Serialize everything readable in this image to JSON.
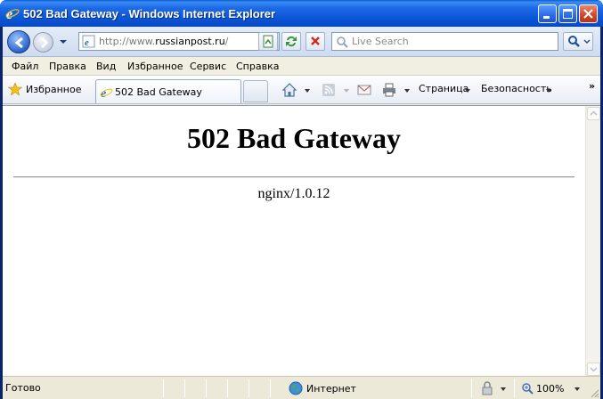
{
  "window": {
    "title": "502 Bad Gateway - Windows Internet Explorer"
  },
  "address": {
    "url_prefix": "http://www.",
    "url_domain": "russianpost.ru",
    "url_suffix": "/"
  },
  "search": {
    "placeholder": "Live Search"
  },
  "menu": {
    "items": [
      "Файл",
      "Правка",
      "Вид",
      "Избранное",
      "Сервис",
      "Справка"
    ]
  },
  "commandbar": {
    "favorites_label": "Избранное",
    "tab_label": "502 Bad Gateway",
    "page_label": "Страница",
    "safety_label": "Безопасность",
    "more_glyph": "»"
  },
  "page": {
    "heading": "502 Bad Gateway",
    "server": "nginx/1.0.12"
  },
  "status": {
    "text": "Готово",
    "zone": "Интернет",
    "zoom": "100%"
  },
  "colors": {
    "titlebar": "#0a55d6",
    "close": "#d2452a"
  }
}
